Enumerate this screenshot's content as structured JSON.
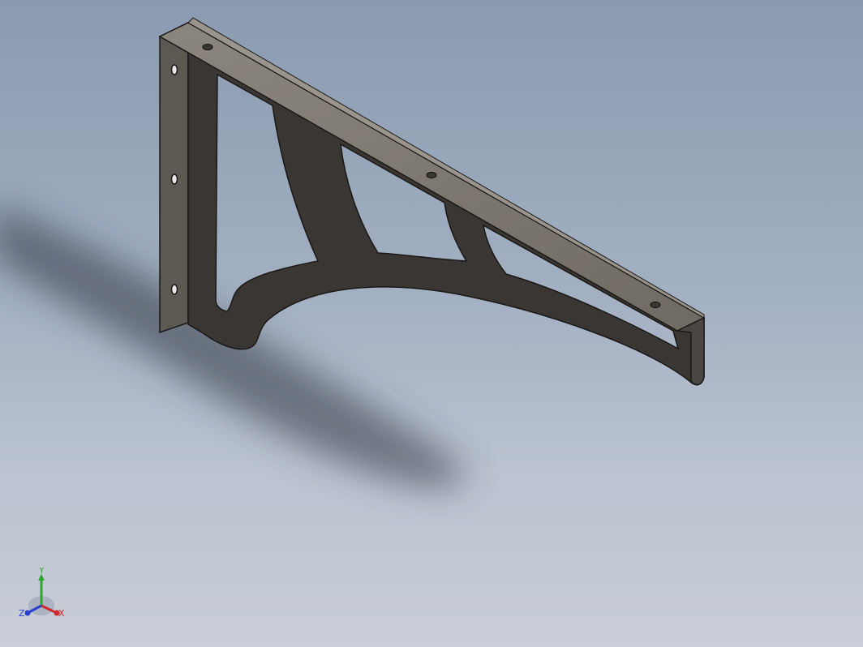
{
  "triad": {
    "x_label": "X",
    "y_label": "Y",
    "z_label": "Z",
    "x_color": "#cc2a2a",
    "y_color": "#2fa52f",
    "z_color": "#2a3fcc"
  },
  "model": {
    "flange_color": "#7a756c",
    "web_color": "#3a3633",
    "edge_color": "#1a1816"
  }
}
